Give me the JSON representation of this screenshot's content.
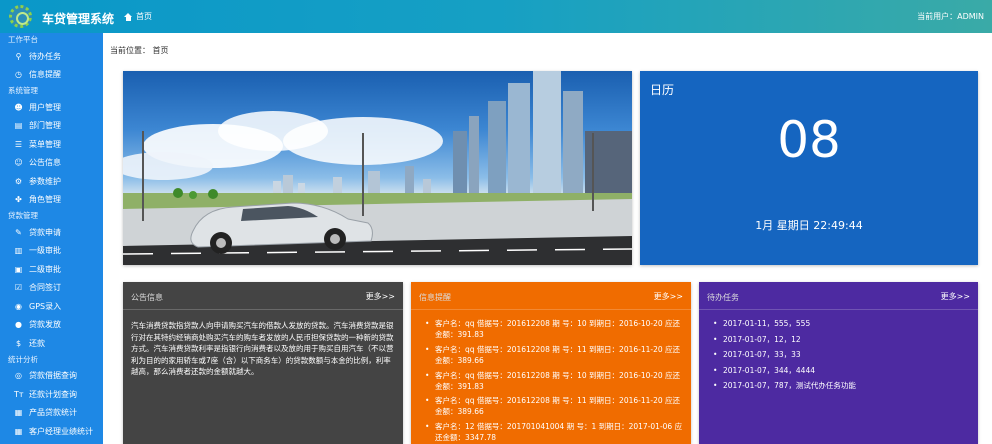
{
  "header": {
    "app_title": "车贷管理系统",
    "home_label": "首页",
    "current_user": "当前用户：ADMIN"
  },
  "sidebar": {
    "groups": [
      {
        "title": "工作平台",
        "items": [
          {
            "label": "待办任务",
            "icon": "bicycle-icon"
          },
          {
            "label": "信息提醒",
            "icon": "alarm-clock-icon"
          }
        ]
      },
      {
        "title": "系统管理",
        "items": [
          {
            "label": "用户管理",
            "icon": "users-icon"
          },
          {
            "label": "部门管理",
            "icon": "building-icon"
          },
          {
            "label": "菜单管理",
            "icon": "list-icon"
          },
          {
            "label": "公告信息",
            "icon": "user-plus-icon"
          },
          {
            "label": "参数维护",
            "icon": "gear-icon"
          },
          {
            "label": "角色管理",
            "icon": "puzzle-icon"
          }
        ]
      },
      {
        "title": "贷款管理",
        "items": [
          {
            "label": "贷款申请",
            "icon": "pencil-icon"
          },
          {
            "label": "一级审批",
            "icon": "book-icon"
          },
          {
            "label": "二级审批",
            "icon": "image-icon"
          },
          {
            "label": "合同签订",
            "icon": "check-square-icon"
          },
          {
            "label": "GPS录入",
            "icon": "location-icon"
          },
          {
            "label": "贷款发放",
            "icon": "coin-icon"
          },
          {
            "label": "还款",
            "icon": "dollar-icon"
          }
        ]
      },
      {
        "title": "统计分析",
        "items": [
          {
            "label": "贷款借据查询",
            "icon": "target-icon"
          },
          {
            "label": "还款计划查询",
            "icon": "text-height-icon"
          },
          {
            "label": "产品贷款统计",
            "icon": "grid-icon"
          },
          {
            "label": "客户经理业绩统计",
            "icon": "table-icon"
          }
        ]
      }
    ]
  },
  "main": {
    "breadcrumb": "当前位置： 首页",
    "calendar": {
      "title": "日历",
      "day": "08",
      "line": "1月 星期日 22:49:44"
    },
    "notice": {
      "title": "公告信息",
      "more": "更多>>",
      "text": "汽车消费贷款指贷款人向申请购买汽车的借款人发放的贷款。汽车消费贷款是银行对在其特约经销商处购买汽车的购车者发放的人民币担保贷款的一种新的贷款方式。汽车消费贷款利率是指银行向消费者以及放的用于购买自用汽车（不以营利为目的的家用轿车或7座（含）以下商务车）的贷款数额与本金的比例，利率越高，那么消费者还款的金额就越大。"
    },
    "alerts": {
      "title": "信息提醒",
      "more": "更多>>",
      "items": [
        "客户名：qq 借据号：201612208 期 号：10 到期日：2016-10-20 应还金额：391.83",
        "客户名：qq 借据号：201612208 期 号：11 到期日：2016-11-20 应还金额：389.66",
        "客户名：qq 借据号：201612208 期 号：10 到期日：2016-10-20 应还金额：391.83",
        "客户名：qq 借据号：201612208 期 号：11 到期日：2016-11-20 应还金额：389.66",
        "客户名：12 借据号：201701041004 期 号：1 到期日：2017-01-06 应还金额：3347.78"
      ]
    },
    "todo": {
      "title": "待办任务",
      "more": "更多>>",
      "items": [
        "2017-01-11，555，555",
        "2017-01-07，12，12",
        "2017-01-07，33，33",
        "2017-01-07，344，4444",
        "2017-01-07，787，测试代办任务功能"
      ]
    }
  }
}
